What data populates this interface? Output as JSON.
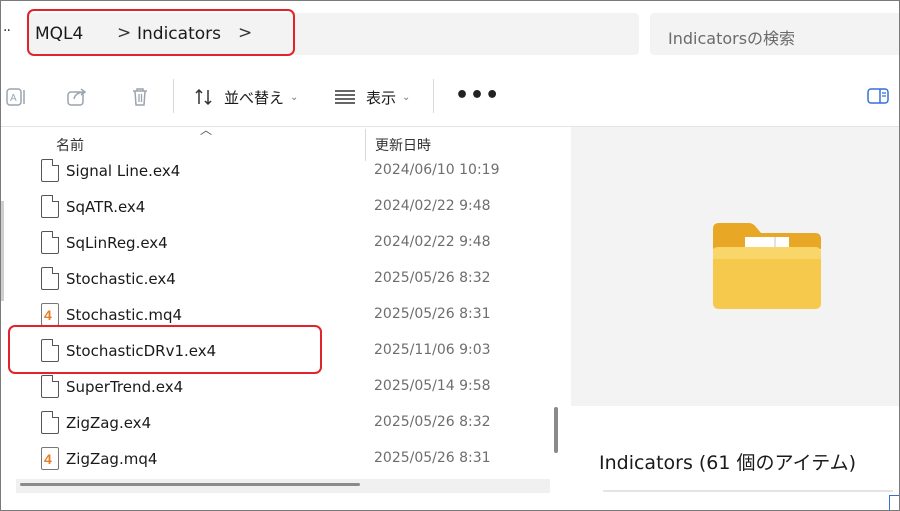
{
  "breadcrumb": {
    "items": [
      "MQL4",
      "Indicators"
    ],
    "separator": ">"
  },
  "search": {
    "placeholder": "Indicatorsの検索"
  },
  "toolbar": {
    "sort_label": "並べ替え",
    "view_label": "表示"
  },
  "columns": {
    "name": "名前",
    "modified": "更新日時"
  },
  "files": [
    {
      "name": "Signal Line.ex4",
      "date": "2024/06/10 10:19",
      "icon": "document-icon"
    },
    {
      "name": "SqATR.ex4",
      "date": "2024/02/22 9:48",
      "icon": "document-icon"
    },
    {
      "name": "SqLinReg.ex4",
      "date": "2024/02/22 9:48",
      "icon": "document-icon"
    },
    {
      "name": "Stochastic.ex4",
      "date": "2025/05/26 8:32",
      "icon": "document-icon"
    },
    {
      "name": "Stochastic.mq4",
      "date": "2025/05/26 8:31",
      "icon": "mq4-file-icon"
    },
    {
      "name": "StochasticDRv1.ex4",
      "date": "2025/11/06 9:03",
      "icon": "document-icon"
    },
    {
      "name": "SuperTrend.ex4",
      "date": "2025/05/14 9:58",
      "icon": "document-icon"
    },
    {
      "name": "ZigZag.ex4",
      "date": "2025/05/26 8:32",
      "icon": "document-icon"
    },
    {
      "name": "ZigZag.mq4",
      "date": "2025/05/26 8:31",
      "icon": "mq4-file-icon"
    }
  ],
  "preview": {
    "title": "Indicators (61 個のアイテム)"
  },
  "colors": {
    "highlight": "#e0242b",
    "folder": "#f5c342",
    "mq4_accent": "#e67e22"
  }
}
